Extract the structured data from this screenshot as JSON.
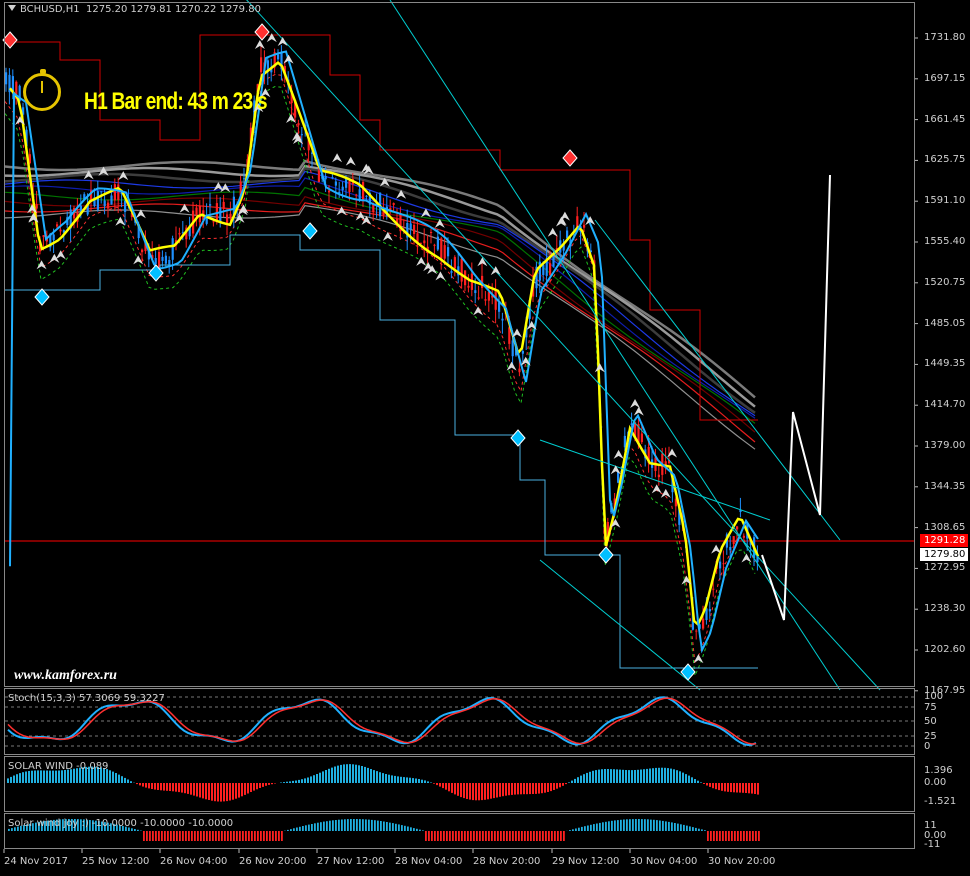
{
  "header": {
    "symbol_label": "BCHUSD,H1",
    "ohlc": "1275.20 1279.81 1270.22 1279.80"
  },
  "bar_end_label": "H1 Bar end: 43 m 23 s",
  "watermark": "www.kamforex.ru",
  "price_axis": [
    "1731.80",
    "1697.15",
    "1661.45",
    "1625.75",
    "1591.10",
    "1555.40",
    "1520.75",
    "1485.05",
    "1449.35",
    "1414.70",
    "1379.00",
    "1344.35",
    "1308.65",
    "1272.95",
    "1238.30",
    "1202.60",
    "1167.95"
  ],
  "price_tags": {
    "red_line": "1291.28",
    "current": "1279.80"
  },
  "stoch": {
    "label": "Stoch(15,3,3) 57.3069 59.3227",
    "levels": [
      "100",
      "75",
      "50",
      "25",
      "0"
    ]
  },
  "solar_wind": {
    "label": "SOLAR WIND -0.089",
    "levels": [
      "1.396",
      "0.00",
      "-1.521"
    ]
  },
  "solar_joy": {
    "label": "Solar wind joy :) -10.0000 -10.0000 -10.0000",
    "levels": [
      "11",
      "0.00",
      "-11"
    ]
  },
  "time_axis": [
    "24 Nov 2017",
    "25 Nov 12:00",
    "26 Nov 04:00",
    "26 Nov 20:00",
    "27 Nov 12:00",
    "28 Nov 04:00",
    "28 Nov 20:00",
    "29 Nov 12:00",
    "30 Nov 04:00",
    "30 Nov 20:00"
  ],
  "colors": {
    "background": "#000000",
    "grid": "#ffffff",
    "bull": "#1e90ff",
    "bear": "#ff2020",
    "red_line": "#ff0000",
    "yellow_ma": "#ffff00",
    "channel": "#00ced1",
    "projection": "#ffffff"
  }
}
